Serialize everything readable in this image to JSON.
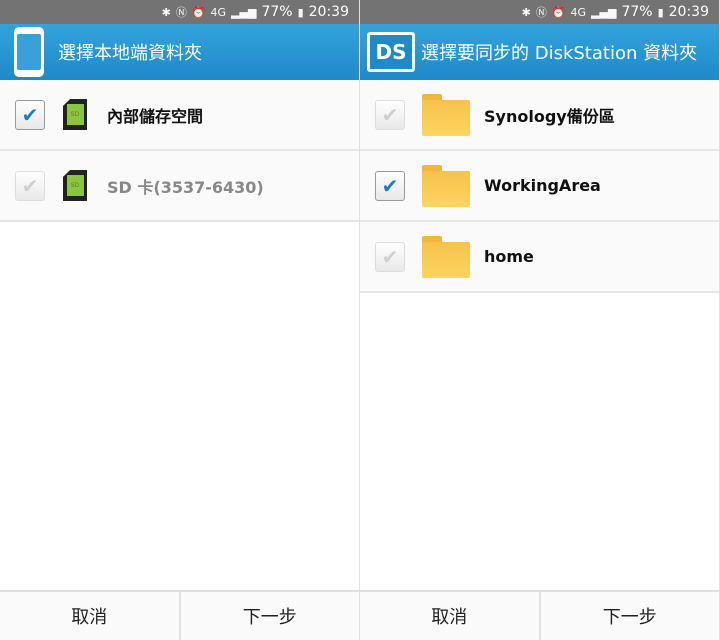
{
  "status_bar": {
    "icons": [
      "bluetooth-icon",
      "nfc-icon",
      "alarm-icon",
      "4g-icon",
      "signal-icon",
      "battery-icon"
    ],
    "network": "4G",
    "battery": "77%",
    "time": "20:39"
  },
  "left": {
    "title": "選擇本地端資料夾",
    "items": [
      {
        "label": "內部儲存空間",
        "checked": true
      },
      {
        "label": "SD 卡(3537-6430)",
        "checked": false
      }
    ],
    "sd_text": "SD",
    "cancel": "取消",
    "next": "下一步"
  },
  "right": {
    "title": "選擇要同步的 DiskStation 資料夾",
    "logo": "DS",
    "items": [
      {
        "label": "Synology備份區",
        "checked": false
      },
      {
        "label": "WorkingArea",
        "checked": true
      },
      {
        "label": "home",
        "checked": false
      }
    ],
    "cancel": "取消",
    "next": "下一步"
  },
  "colors": {
    "header": "#2596d2",
    "check": "#1e7fc0",
    "folder": "#f7c24a"
  }
}
